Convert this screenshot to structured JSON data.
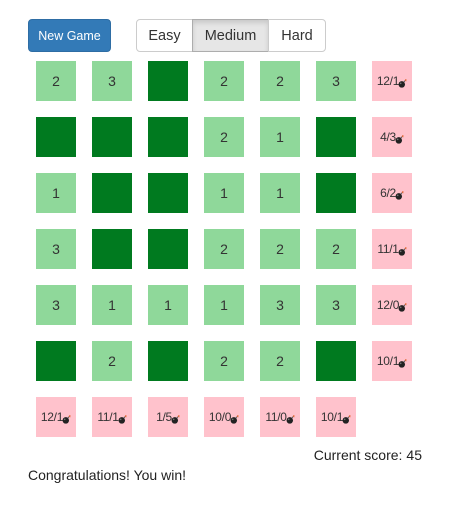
{
  "toolbar": {
    "new_game_label": "New Game",
    "difficulties": [
      "Easy",
      "Medium",
      "Hard"
    ],
    "selected_difficulty": "Medium"
  },
  "colors": {
    "revealed": "#8fd89a",
    "unrevealed": "#007a1f",
    "hint": "#ffc2cc",
    "primary": "#337ab7"
  },
  "board": {
    "cells": [
      [
        "2",
        "3",
        "",
        "2",
        "2",
        "3"
      ],
      [
        "",
        "",
        "",
        "2",
        "1",
        ""
      ],
      [
        "1",
        "",
        "",
        "1",
        "1",
        ""
      ],
      [
        "3",
        "",
        "",
        "2",
        "2",
        "2"
      ],
      [
        "3",
        "1",
        "1",
        "1",
        "3",
        "3"
      ],
      [
        "",
        "2",
        "",
        "2",
        "2",
        ""
      ]
    ],
    "cell_states": [
      [
        "revealed",
        "revealed",
        "unrevealed",
        "revealed",
        "revealed",
        "revealed"
      ],
      [
        "unrevealed",
        "unrevealed",
        "unrevealed",
        "revealed",
        "revealed",
        "unrevealed"
      ],
      [
        "revealed",
        "unrevealed",
        "unrevealed",
        "revealed",
        "revealed",
        "unrevealed"
      ],
      [
        "revealed",
        "unrevealed",
        "unrevealed",
        "revealed",
        "revealed",
        "revealed"
      ],
      [
        "revealed",
        "revealed",
        "revealed",
        "revealed",
        "revealed",
        "revealed"
      ],
      [
        "unrevealed",
        "revealed",
        "unrevealed",
        "revealed",
        "revealed",
        "unrevealed"
      ]
    ],
    "row_hints": [
      "12/1",
      "4/3",
      "6/2",
      "11/1",
      "12/0",
      "10/1"
    ],
    "col_hints": [
      "12/1",
      "11/1",
      "1/5",
      "10/0",
      "11/0",
      "10/1"
    ],
    "hint_icon": "bomb-icon"
  },
  "status": {
    "score_label": "Current score:",
    "score_value": "45",
    "message": "Congratulations! You win!"
  }
}
